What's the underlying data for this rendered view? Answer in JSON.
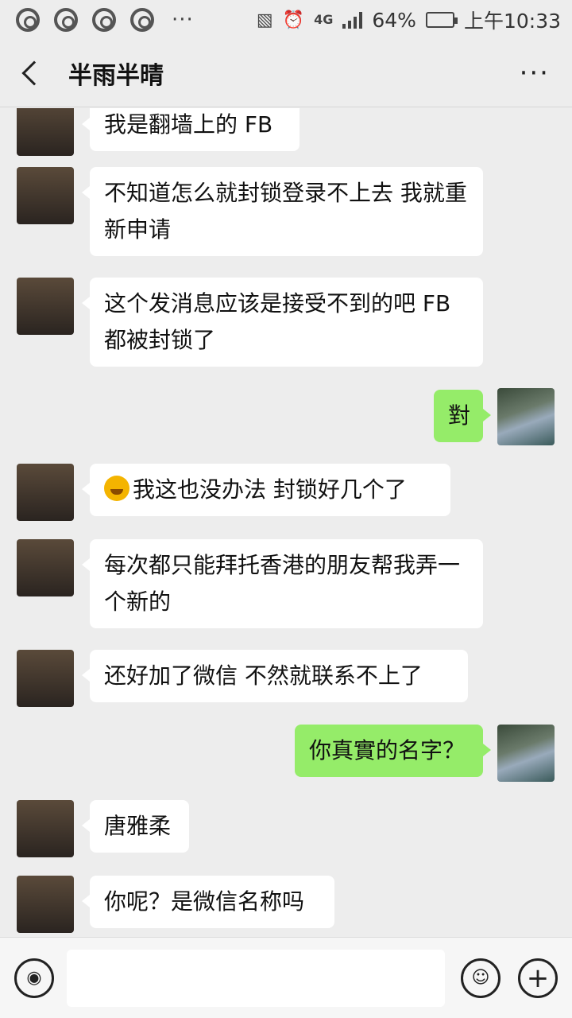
{
  "status_bar": {
    "dots": "···",
    "network": "4G",
    "battery": "64%",
    "time": "上午10:33",
    "icons": [
      "chrome-icon",
      "chrome-icon",
      "chrome-icon",
      "chrome-icon",
      "vibrate-icon",
      "alarm-icon",
      "signal-icon",
      "battery-icon"
    ]
  },
  "header": {
    "title": "半雨半晴",
    "more": "···"
  },
  "messages": [
    {
      "side": "in",
      "text": "我是翻墙上的 FB"
    },
    {
      "side": "in",
      "text": "不知道怎么就封锁登录不上去 我就重新申请"
    },
    {
      "side": "in",
      "text": "这个发消息应该是接受不到的吧 FB 都被封锁了"
    },
    {
      "side": "out",
      "text": "對"
    },
    {
      "side": "in",
      "text": "我这也没办法 封锁好几个了",
      "emoji": "sweat-laugh-emoji"
    },
    {
      "side": "in",
      "text": "每次都只能拜托香港的朋友帮我弄一个新的"
    },
    {
      "side": "in",
      "text": "还好加了微信  不然就联系不上了"
    },
    {
      "side": "out",
      "text": "你真實的名字？"
    },
    {
      "side": "in",
      "text": "唐雅柔"
    },
    {
      "side": "in",
      "text": "你呢？是微信名称吗"
    }
  ],
  "input_bar": {
    "placeholder": "",
    "voice_icon": "voice-icon",
    "emoji_icon": "emoji-icon",
    "plus_icon": "plus-icon"
  }
}
